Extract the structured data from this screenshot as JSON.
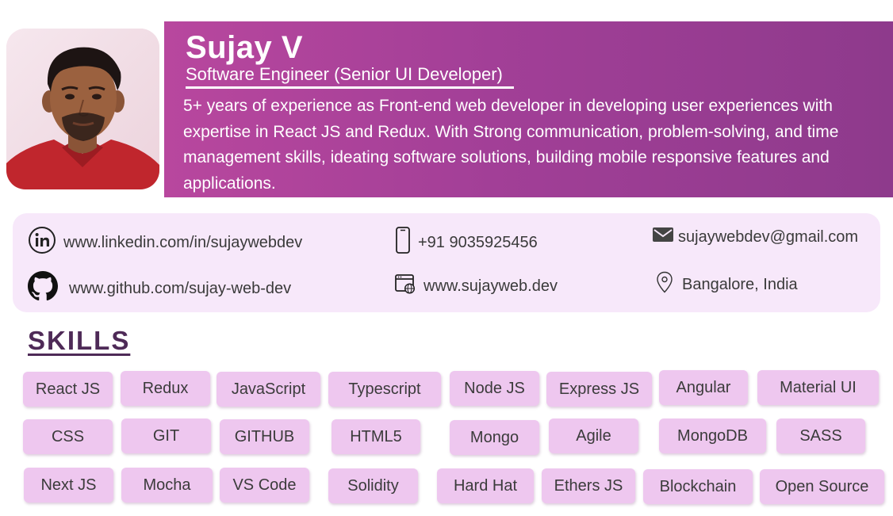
{
  "profile": {
    "name": "Sujay V",
    "role": "Software Engineer (Senior UI Developer)",
    "summary": "5+ years of experience as Front-end web developer in developing user experiences with expertise in React JS and Redux. With Strong communication, problem-solving, and time management skills, ideating software solutions, building mobile responsive features and applications."
  },
  "contact": {
    "linkedin": {
      "icon": "linkedin-icon",
      "text": "www.linkedin.com/in/sujaywebdev"
    },
    "phone": {
      "icon": "phone-icon",
      "text": "+91 9035925456"
    },
    "email": {
      "icon": "mail-icon",
      "text": "sujaywebdev@gmail.com"
    },
    "github": {
      "icon": "github-icon",
      "text": "www.github.com/sujay-web-dev"
    },
    "website": {
      "icon": "browser-globe-icon",
      "text": "www.sujayweb.dev"
    },
    "location": {
      "icon": "location-pin-icon",
      "text": "Bangalore, India"
    }
  },
  "skills": {
    "title": "SKILLS",
    "items": [
      "React JS",
      "Redux",
      "JavaScript",
      "Typescript",
      "Node JS",
      "Express JS",
      "Angular",
      "Material UI",
      "CSS",
      "GIT",
      "GITHUB",
      "HTML5",
      "Mongo",
      "Agile",
      "MongoDB",
      "SASS",
      "Next JS",
      "Mocha",
      "VS Code",
      "Solidity",
      "Hard Hat",
      "Ethers JS",
      "Blockchain",
      "Open Source"
    ]
  },
  "colors": {
    "banner_start": "#b8479e",
    "banner_end": "#8e3a8c",
    "contact_bg": "#f7e8fa",
    "chip_bg": "#eec7ef",
    "heading": "#4e2a57"
  }
}
